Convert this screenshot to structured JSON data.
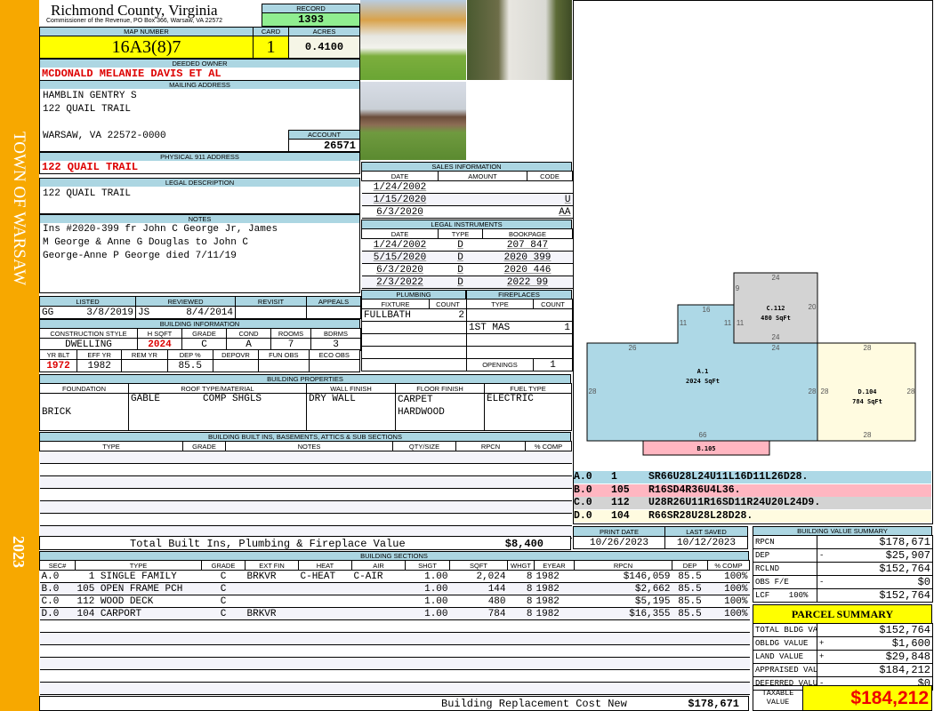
{
  "sidebar": {
    "town": "TOWN OF WARSAW",
    "year": "2023"
  },
  "header": {
    "title": "Richmond County, Virginia",
    "subtitle": "Commissioner of the Revenue, PO Box 366, Warsaw, VA 22572",
    "record_label": "RECORD",
    "record": "1393"
  },
  "parcel": {
    "map_number_label": "MAP NUMBER",
    "map_number": "16A3(8)7",
    "card_label": "CARD",
    "card": "1",
    "acres_label": "ACRES",
    "acres": "0.4100"
  },
  "owner": {
    "label": "DEEDED OWNER",
    "name": "MCDONALD MELANIE DAVIS ET AL"
  },
  "mailing": {
    "label": "MAILING ADDRESS",
    "lines": [
      "HAMBLIN GENTRY S",
      "122 QUAIL TRAIL",
      "",
      "WARSAW, VA 22572-0000"
    ],
    "account_label": "ACCOUNT",
    "account": "26571"
  },
  "physical": {
    "label": "PHYSICAL 911 ADDRESS",
    "address": "122 QUAIL TRAIL"
  },
  "legal": {
    "label": "LEGAL DESCRIPTION",
    "text": "122 QUAIL TRAIL"
  },
  "notes": {
    "label": "NOTES",
    "lines": [
      "Ins #2020-399 fr John C George Jr, James",
      "M George & Anne G Douglas to John C",
      "George-Anne P George died 7/11/19"
    ]
  },
  "review": {
    "headers": [
      "LISTED",
      "REVIEWED",
      "REVISIT",
      "APPEALS"
    ],
    "listed_by": "GG",
    "listed": "3/8/2019",
    "reviewed_by": "JS",
    "reviewed": "8/4/2014",
    "revisit": "",
    "appeals": ""
  },
  "building_info": {
    "label": "BUILDING INFORMATION",
    "headers1": [
      "CONSTRUCTION STYLE",
      "H SQFT",
      "GRADE",
      "COND",
      "ROOMS",
      "BDRMS"
    ],
    "values1": [
      "DWELLING",
      "2024",
      "C",
      "A",
      "7",
      "3"
    ],
    "headers2": [
      "YR BLT",
      "EFF YR",
      "REM YR",
      "DEP %",
      "DEPOVR",
      "FUN OBS",
      "ECO OBS"
    ],
    "values2": [
      "1972",
      "1982",
      "",
      "85.5",
      "",
      "",
      ""
    ]
  },
  "building_props": {
    "label": "BUILDING PROPERTIES",
    "headers": [
      "FOUNDATION",
      "ROOF TYPE/MATERIAL",
      "WALL FINISH",
      "FLOOR FINISH",
      "FUEL TYPE"
    ],
    "foundation": "BRICK",
    "roof_type": "GABLE",
    "roof_material": "COMP SHGLS",
    "wall": "DRY WALL",
    "floor": [
      "CARPET",
      "HARDWOOD"
    ],
    "fuel": "ELECTRIC"
  },
  "built_ins": {
    "label": "BUILDING BUILT INS, BASEMENTS, ATTICS & SUB SECTIONS",
    "headers": [
      "TYPE",
      "GRADE",
      "NOTES",
      "QTY/SIZE",
      "RPCN",
      "% COMP"
    ],
    "total_label": "Total Built Ins, Plumbing & Fireplace Value",
    "total": "$8,400"
  },
  "sales": {
    "label": "SALES INFORMATION",
    "headers": [
      "DATE",
      "AMOUNT",
      "CODE"
    ],
    "rows": [
      [
        "1/24/2002",
        "",
        ""
      ],
      [
        "1/15/2020",
        "",
        "U"
      ],
      [
        "6/3/2020",
        "",
        "AA"
      ]
    ]
  },
  "instruments": {
    "label": "LEGAL INSTRUMENTS",
    "headers": [
      "DATE",
      "TYPE",
      "BOOKPAGE"
    ],
    "rows": [
      [
        "1/24/2002",
        "D",
        "207 847"
      ],
      [
        "5/15/2020",
        "D",
        "2020 399"
      ],
      [
        "6/3/2020",
        "D",
        "2020 446"
      ],
      [
        "2/3/2022",
        "D",
        "2022 99"
      ]
    ]
  },
  "plumbing": {
    "label": "PLUMBING",
    "headers": [
      "FIXTURE",
      "COUNT"
    ],
    "rows": [
      [
        "FULLBATH",
        "2"
      ]
    ]
  },
  "fireplaces": {
    "label": "FIREPLACES",
    "headers": [
      "TYPE",
      "COUNT"
    ],
    "rows": [
      [
        "1ST MAS",
        "1"
      ]
    ],
    "openings_label": "OPENINGS",
    "openings": "1"
  },
  "sketch": {
    "labels": {
      "a_name": "A.1",
      "a_area": "2024 SqFt",
      "c_name": "C.112",
      "c_area": "480 SqFt",
      "d_name": "D.104",
      "d_area": "784 SqFt",
      "b_name": "B.105"
    },
    "dims": [
      "26",
      "16",
      "11",
      "11",
      "11",
      "9",
      "24",
      "20",
      "24",
      "24",
      "28",
      "28",
      "28",
      "66",
      "28",
      "28",
      "28"
    ],
    "codes": [
      [
        "A.0",
        "1",
        "SR66U28L24U11L16D11L26D28."
      ],
      [
        "B.0",
        "105",
        "R16SD4R36U4L36."
      ],
      [
        "C.0",
        "112",
        "U28R26U11R16SD11R24U20L24D9."
      ],
      [
        "D.0",
        "104",
        "R66SR28U28L28D28."
      ]
    ],
    "colors": {
      "A": "#add8e6",
      "B": "#ffb6c1",
      "C": "#d3d3d3",
      "D": "#fffbe0"
    }
  },
  "dates": {
    "print_label": "PRINT DATE",
    "print": "10/26/2023",
    "saved_label": "LAST SAVED",
    "saved": "10/12/2023"
  },
  "sections": {
    "label": "BUILDING SECTIONS",
    "headers": [
      "SEC#",
      "TYPE",
      "GRADE",
      "EXT FIN",
      "HEAT",
      "AIR",
      "SHGT",
      "SQFT",
      "WHGT",
      "EYEAR",
      "RPCN",
      "DEP",
      "% COMP"
    ],
    "rows": [
      [
        "A.0",
        "  1 SINGLE FAMILY",
        "C",
        "BRKVR",
        "C-HEAT",
        "C-AIR",
        "1.00",
        "2,024",
        "8",
        "1982",
        "$146,059",
        "85.5",
        "100%"
      ],
      [
        "B.0",
        "105 OPEN FRAME PCH",
        "C",
        "",
        "",
        "",
        "1.00",
        "144",
        "8",
        "1982",
        "$2,662",
        "85.5",
        "100%"
      ],
      [
        "C.0",
        "112 WOOD DECK",
        "C",
        "",
        "",
        "",
        "1.00",
        "480",
        "8",
        "1982",
        "$5,195",
        "85.5",
        "100%"
      ],
      [
        "D.0",
        "104 CARPORT",
        "C",
        "BRKVR",
        "",
        "",
        "1.00",
        "784",
        "8",
        "1982",
        "$16,355",
        "85.5",
        "100%"
      ]
    ],
    "total_label": "Building Replacement Cost New",
    "total": "$178,671"
  },
  "value_summary": {
    "label": "BUILDING VALUE SUMMARY",
    "rows": [
      [
        "RPCN",
        "",
        "$178,671"
      ],
      [
        "DEP",
        "-",
        "$25,907"
      ],
      [
        "RCLND",
        "",
        "$152,764"
      ],
      [
        "OBS F/E",
        "-",
        "$0"
      ],
      [
        "LCF    100%",
        "",
        "$152,764"
      ]
    ]
  },
  "parcel_summary": {
    "label": "PARCEL SUMMARY",
    "rows": [
      [
        "TOTAL BLDG VALUE",
        "",
        "$152,764"
      ],
      [
        "OBLDG VALUE",
        "+",
        "$1,600"
      ],
      [
        "LAND VALUE",
        "+",
        "$29,848"
      ],
      [
        "APPRAISED VALUE",
        "",
        "$184,212"
      ],
      [
        "DEFERRED VALUE",
        "-",
        "$0"
      ]
    ],
    "taxable_label": "TAXABLE VALUE",
    "taxable": "$184,212"
  }
}
